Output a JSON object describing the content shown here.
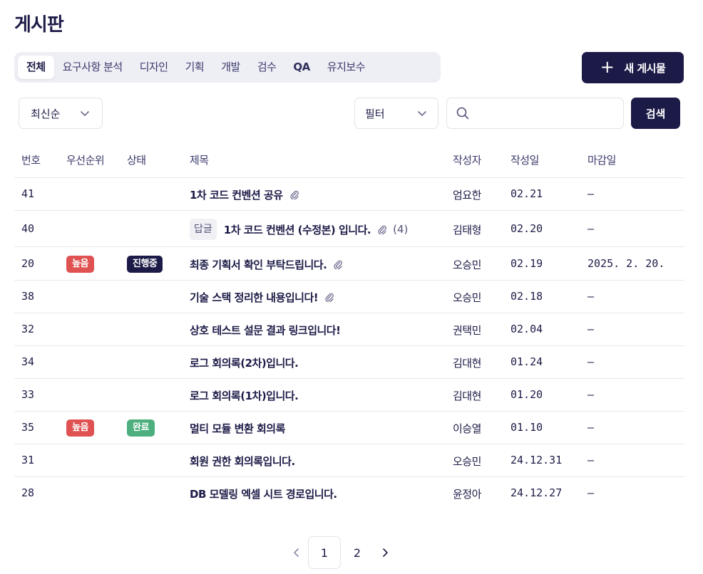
{
  "page_title": "게시판",
  "tabs": [
    {
      "label": "전체",
      "active": true
    },
    {
      "label": "요구사항 분석",
      "active": false
    },
    {
      "label": "디자인",
      "active": false
    },
    {
      "label": "기획",
      "active": false
    },
    {
      "label": "개발",
      "active": false
    },
    {
      "label": "검수",
      "active": false
    },
    {
      "label": "QA",
      "active": false
    },
    {
      "label": "유지보수",
      "active": false
    }
  ],
  "new_post_label": "새 게시물",
  "sort": {
    "selected": "최신순"
  },
  "filter": {
    "selected": "필터"
  },
  "search": {
    "placeholder": "",
    "button_label": "검색"
  },
  "columns": {
    "num": "번호",
    "priority": "우선순위",
    "status": "상태",
    "title": "제목",
    "author": "작성자",
    "created": "작성일",
    "due": "마감일"
  },
  "rows": [
    {
      "num": "41",
      "priority": "",
      "status": "",
      "reply_tag": "",
      "title": "1차 코드 컨벤션 공유",
      "attachment": true,
      "comments": "",
      "author": "엄요한",
      "created": "02.21",
      "due": "–"
    },
    {
      "num": "40",
      "priority": "",
      "status": "",
      "reply_tag": "답글",
      "title": "1차 코드 컨벤션 (수정본) 입니다.",
      "attachment": true,
      "comments": "(4)",
      "author": "김태형",
      "created": "02.20",
      "due": "–"
    },
    {
      "num": "20",
      "priority": "높음",
      "status": "진행중",
      "reply_tag": "",
      "title": "최종 기획서 확인 부탁드립니다.",
      "attachment": true,
      "comments": "",
      "author": "오승민",
      "created": "02.19",
      "due": "2025. 2. 20."
    },
    {
      "num": "38",
      "priority": "",
      "status": "",
      "reply_tag": "",
      "title": "기술 스택 정리한 내용입니다!",
      "attachment": true,
      "comments": "",
      "author": "오승민",
      "created": "02.18",
      "due": "–"
    },
    {
      "num": "32",
      "priority": "",
      "status": "",
      "reply_tag": "",
      "title": "상호 테스트 설문 결과 링크입니다!",
      "attachment": false,
      "comments": "",
      "author": "권택민",
      "created": "02.04",
      "due": "–"
    },
    {
      "num": "34",
      "priority": "",
      "status": "",
      "reply_tag": "",
      "title": "로그 회의록(2차)입니다.",
      "attachment": false,
      "comments": "",
      "author": "김대현",
      "created": "01.24",
      "due": "–"
    },
    {
      "num": "33",
      "priority": "",
      "status": "",
      "reply_tag": "",
      "title": "로그 회의록(1차)입니다.",
      "attachment": false,
      "comments": "",
      "author": "김대현",
      "created": "01.20",
      "due": "–"
    },
    {
      "num": "35",
      "priority": "높음",
      "status": "완료",
      "reply_tag": "",
      "title": "멀티 모듈 변환 회의록",
      "attachment": false,
      "comments": "",
      "author": "이승열",
      "created": "01.10",
      "due": "–"
    },
    {
      "num": "31",
      "priority": "",
      "status": "",
      "reply_tag": "",
      "title": "회원 권한 회의록입니다.",
      "attachment": false,
      "comments": "",
      "author": "오승민",
      "created": "24.12.31",
      "due": "–"
    },
    {
      "num": "28",
      "priority": "",
      "status": "",
      "reply_tag": "",
      "title": "DB 모델링 엑셀 시트 경로입니다.",
      "attachment": false,
      "comments": "",
      "author": "윤정아",
      "created": "24.12.27",
      "due": "–"
    }
  ],
  "pagination": {
    "pages": [
      "1",
      "2"
    ],
    "current": "1"
  },
  "colors": {
    "primary": "#1c1b47",
    "high": "#e05252",
    "progress": "#1c1b47",
    "done": "#4caf7d"
  }
}
